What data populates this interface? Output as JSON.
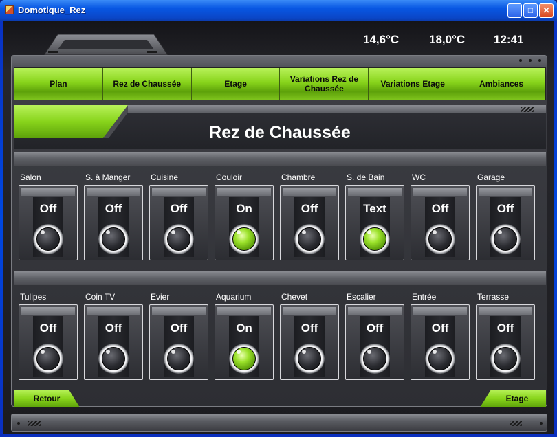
{
  "window": {
    "title": "Domotique_Rez",
    "controls": {
      "minimize": "_",
      "maximize": "□",
      "close": "✕"
    }
  },
  "status": {
    "temp_indoor": "14,6°C",
    "temp_outdoor": "18,0°C",
    "time": "12:41"
  },
  "menu": {
    "items": [
      {
        "label": "Plan"
      },
      {
        "label": "Rez de Chaussée"
      },
      {
        "label": "Etage"
      },
      {
        "label": "Variations Rez de Chaussée"
      },
      {
        "label": "Variations Etage"
      },
      {
        "label": "Ambiances"
      }
    ]
  },
  "page": {
    "title": "Rez de Chaussée"
  },
  "lights_row1": [
    {
      "label": "Salon",
      "state": "Off",
      "on": false
    },
    {
      "label": "S. à Manger",
      "state": "Off",
      "on": false
    },
    {
      "label": "Cuisine",
      "state": "Off",
      "on": false
    },
    {
      "label": "Couloir",
      "state": "On",
      "on": true
    },
    {
      "label": "Chambre",
      "state": "Off",
      "on": false
    },
    {
      "label": "S. de Bain",
      "state": "Text",
      "on": true
    },
    {
      "label": "WC",
      "state": "Off",
      "on": false
    },
    {
      "label": "Garage",
      "state": "Off",
      "on": false
    }
  ],
  "lights_row2": [
    {
      "label": "Tulipes",
      "state": "Off",
      "on": false
    },
    {
      "label": "Coin TV",
      "state": "Off",
      "on": false
    },
    {
      "label": "Evier",
      "state": "Off",
      "on": false
    },
    {
      "label": "Aquarium",
      "state": "On",
      "on": true
    },
    {
      "label": "Chevet",
      "state": "Off",
      "on": false
    },
    {
      "label": "Escalier",
      "state": "Off",
      "on": false
    },
    {
      "label": "Entrée",
      "state": "Off",
      "on": false
    },
    {
      "label": "Terrasse",
      "state": "Off",
      "on": false
    }
  ],
  "nav": {
    "back": "Retour",
    "next": "Etage"
  },
  "colors": {
    "accent_green": "#8fd81f",
    "led_on": "#9be22a",
    "led_off": "#2a2b30"
  }
}
